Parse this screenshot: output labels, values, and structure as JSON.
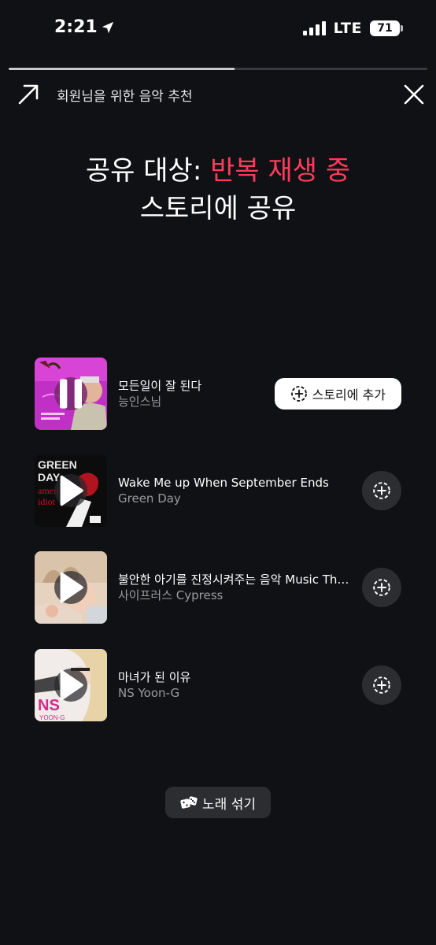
{
  "status_bar": {
    "time": "2:21",
    "network": "LTE",
    "battery": "71"
  },
  "progress": {
    "value": 0.54
  },
  "header": {
    "title": "회원님을 위한 음악 추천"
  },
  "heading": {
    "prefix": "공유 대상: ",
    "accent": "반복 재생 중",
    "line2": "스토리에 공유",
    "accent_color": "#ff3b5c"
  },
  "tracks": [
    {
      "title": "모든일이 잘 된다",
      "artist": "능인스님",
      "state": "playing",
      "action_label": "스토리에 추가"
    },
    {
      "title": "Wake Me up When September Ends",
      "artist": "Green Day",
      "state": "paused"
    },
    {
      "title": "불안한 아기를 진정시켜주는 음악 Music That Calms Anxious Babies",
      "artist": "사이프러스 Cypress",
      "state": "paused"
    },
    {
      "title": "마녀가 된 이유",
      "artist": "NS Yoon-G",
      "state": "paused"
    }
  ],
  "shuffle": {
    "label": "노래 섞기"
  },
  "icons": {
    "location": "location-arrow-icon",
    "share": "share-arrow-icon",
    "close": "close-icon",
    "add": "add-circle-icon",
    "play": "play-icon",
    "pause": "pause-icon",
    "dice": "dice-icon"
  }
}
